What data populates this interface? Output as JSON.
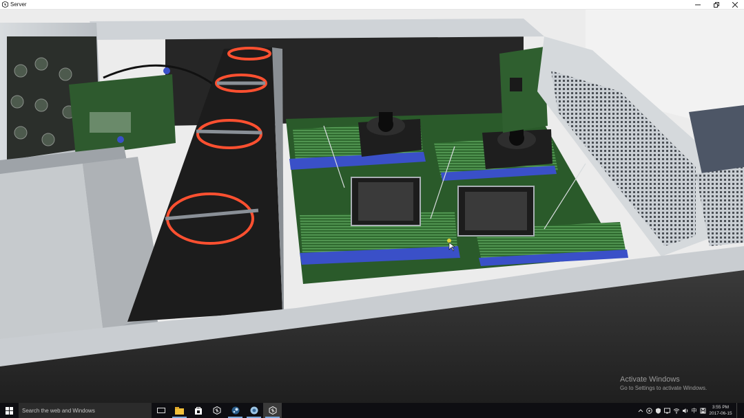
{
  "window": {
    "title": "Server"
  },
  "watermark": {
    "title": "Activate Windows",
    "subtitle": "Go to Settings to activate Windows."
  },
  "taskbar": {
    "search_placeholder": "Search the web and Windows",
    "apps": [
      "task-view",
      "file-explorer",
      "store",
      "unity",
      "steam",
      "app",
      "unity-active"
    ],
    "clock": {
      "time": "3:55 PM",
      "date": "2017-06-15"
    },
    "tray": [
      "chevron-up",
      "network-alt",
      "shield",
      "remote",
      "wifi",
      "volume",
      "ime-zh",
      "ime-mode"
    ],
    "ime_label": "中"
  },
  "colors": {
    "accent": "#3a50c8",
    "fan_ring": "#ff5030",
    "pcb": "#3c7a3c",
    "chassis": "#c8cdd2"
  }
}
